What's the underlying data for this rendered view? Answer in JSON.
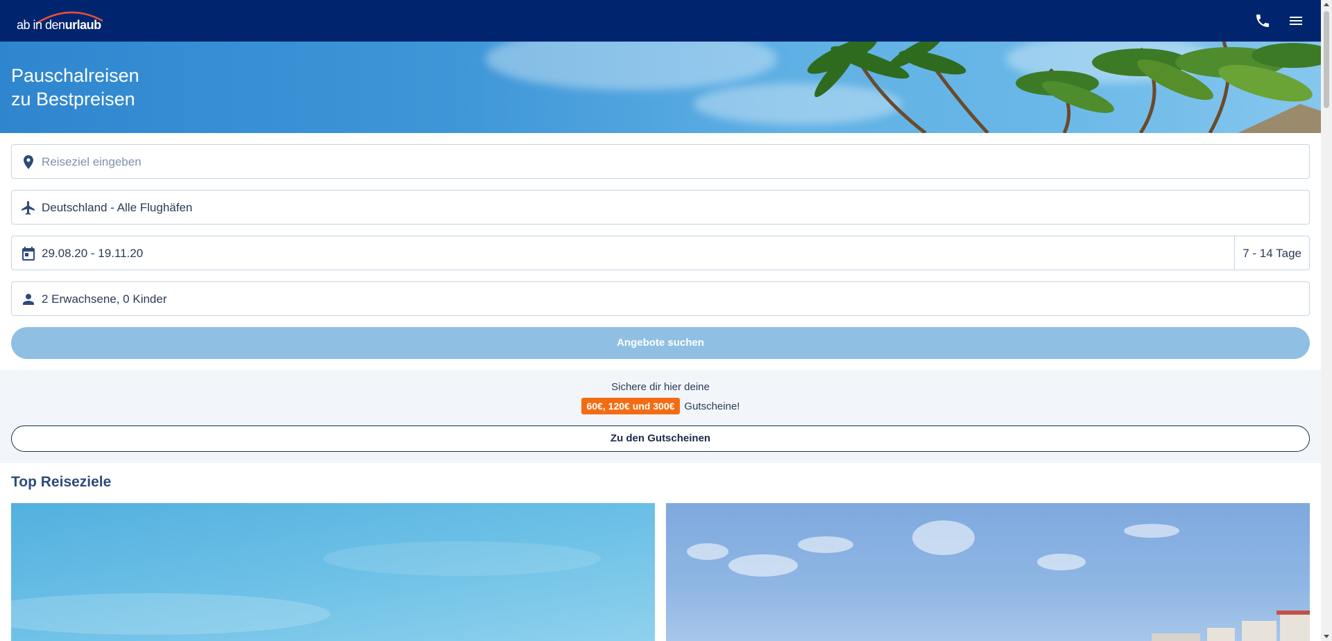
{
  "header": {
    "logo_text_light": "ab in den",
    "logo_text_bold": "urlaub",
    "icons": [
      "phone-icon",
      "menu-icon"
    ],
    "background": "#00256e"
  },
  "hero": {
    "title_line1": "Pauschalreisen",
    "title_line2": "zu Bestpreisen"
  },
  "search": {
    "destination_placeholder": "Reiseziel eingeben",
    "airport_value": "Deutschland - Alle Flughäfen",
    "dates_value": "29.08.20 - 19.11.20",
    "duration_value": "7 - 14 Tage",
    "travellers_value": "2 Erwachsene, 0 Kinder",
    "submit_label": "Angebote suchen",
    "icons": [
      "location-pin-icon",
      "airplane-icon",
      "calendar-icon",
      "person-icon"
    ]
  },
  "voucher": {
    "line1": "Sichere dir hier deine",
    "badge": "60€, 120€ und 300€",
    "suffix": "Gutscheine!",
    "button_label": "Zu den Gutscheinen",
    "badge_color": "#f36c14"
  },
  "top_destinations": {
    "title": "Top Reiseziele"
  },
  "colors": {
    "primary": "#00256e",
    "button_disabled": "#8fc0e3",
    "voucher_bg": "#f2f6fb"
  }
}
